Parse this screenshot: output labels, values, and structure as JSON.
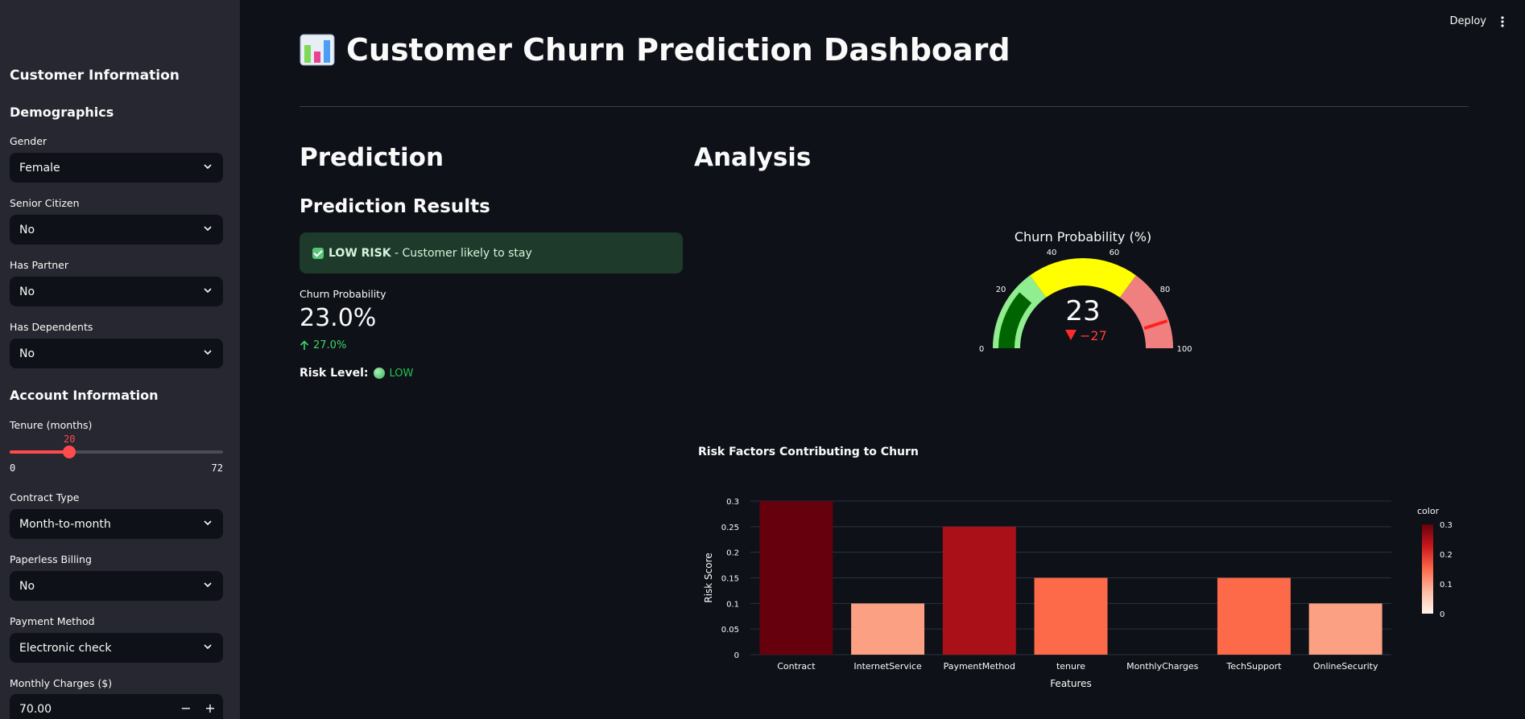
{
  "sidebar": {
    "heading": "Customer Information",
    "demographics_heading": "Demographics",
    "gender": {
      "label": "Gender",
      "value": "Female"
    },
    "senior": {
      "label": "Senior Citizen",
      "value": "No"
    },
    "partner": {
      "label": "Has Partner",
      "value": "No"
    },
    "dependents": {
      "label": "Has Dependents",
      "value": "No"
    },
    "account_heading": "Account Information",
    "tenure": {
      "label": "Tenure (months)",
      "value": 20,
      "min": "0",
      "max": "72",
      "value_text": "20"
    },
    "contract": {
      "label": "Contract Type",
      "value": "Month-to-month"
    },
    "paperless": {
      "label": "Paperless Billing",
      "value": "No"
    },
    "payment": {
      "label": "Payment Method",
      "value": "Electronic check"
    },
    "monthly": {
      "label": "Monthly Charges ($)",
      "value": "70.00",
      "minus": "−",
      "plus": "+"
    }
  },
  "header": {
    "deploy_label": "Deploy"
  },
  "main": {
    "title": "Customer Churn Prediction Dashboard",
    "prediction_heading": "Prediction",
    "analysis_heading": "Analysis",
    "results_heading": "Prediction Results",
    "alert_bold": "LOW RISK",
    "alert_text": " - Customer likely to stay",
    "metric_label": "Churn Probability",
    "metric_value": "23.0%",
    "metric_delta": "27.0%",
    "risk_label": "Risk Level:",
    "risk_value": "LOW"
  },
  "colors": {
    "accent": "#ff4b4b",
    "success": "#21c354",
    "background": "#0e1117",
    "sidebar": "#262730"
  },
  "chart_data": [
    {
      "type": "gauge",
      "title": "Churn Probability (%)",
      "value": 23,
      "delta": -27,
      "delta_text": "−27",
      "range": [
        0,
        100
      ],
      "ticks": [
        0,
        20,
        40,
        60,
        80,
        100
      ],
      "steps": [
        {
          "range": [
            0,
            30
          ],
          "color": "#90ee90"
        },
        {
          "range": [
            30,
            70
          ],
          "color": "#ffff00"
        },
        {
          "range": [
            70,
            100
          ],
          "color": "#f08080"
        }
      ],
      "bar_color": "#006400",
      "threshold": 90
    },
    {
      "type": "bar",
      "title": "Risk Factors Contributing to Churn",
      "xlabel": "Features",
      "ylabel": "Risk Score",
      "categories": [
        "Contract",
        "InternetService",
        "PaymentMethod",
        "tenure",
        "MonthlyCharges",
        "TechSupport",
        "OnlineSecurity"
      ],
      "values": [
        0.3,
        0.1,
        0.25,
        0.15,
        0,
        0.15,
        0.1
      ],
      "ylim": [
        0,
        0.3
      ],
      "yticks": [
        "0",
        "0.05",
        "0.1",
        "0.15",
        "0.2",
        "0.25",
        "0.3"
      ],
      "colorscale": "Reds",
      "colorbar": {
        "title": "color",
        "ticks": [
          "0",
          "0.1",
          "0.2",
          "0.3"
        ]
      }
    }
  ]
}
